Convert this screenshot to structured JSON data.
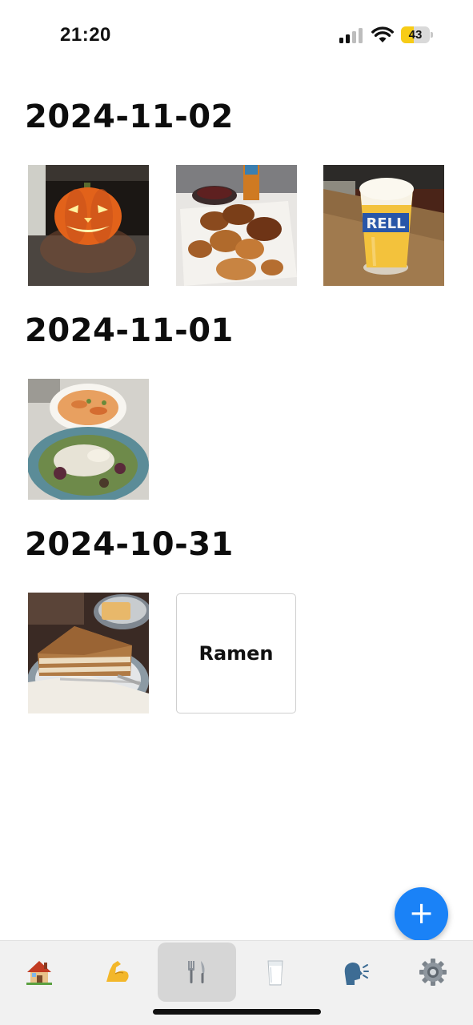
{
  "status_bar": {
    "time": "21:20",
    "battery_level": "43",
    "battery_fraction": 0.43,
    "signal_bars": 2
  },
  "sections": [
    {
      "date": "2024-11-02",
      "items": [
        {
          "type": "photo",
          "icon": "jack-o-lantern-photo"
        },
        {
          "type": "photo",
          "icon": "fried-chicken-wings-photo"
        },
        {
          "type": "photo",
          "icon": "beer-glass-photo"
        }
      ]
    },
    {
      "date": "2024-11-01",
      "items": [
        {
          "type": "photo",
          "icon": "pasta-and-salad-photo"
        }
      ]
    },
    {
      "date": "2024-10-31",
      "items": [
        {
          "type": "photo",
          "icon": "layer-cake-photo"
        },
        {
          "type": "text",
          "label": "Ramen"
        }
      ]
    }
  ],
  "fab": {
    "label": "+"
  },
  "tab_bar": {
    "active_index": 2,
    "tabs": [
      {
        "icon": "house-icon"
      },
      {
        "icon": "flexed-biceps-icon"
      },
      {
        "icon": "fork-and-knife-icon"
      },
      {
        "icon": "glass-of-milk-icon"
      },
      {
        "icon": "speaking-head-icon"
      },
      {
        "icon": "gear-icon"
      }
    ]
  },
  "colors": {
    "accent": "#1a82f7",
    "tab_bar_bg": "#f1f1f1",
    "active_tab_bg": "#d6d6d6",
    "battery": "#f7cc16"
  }
}
